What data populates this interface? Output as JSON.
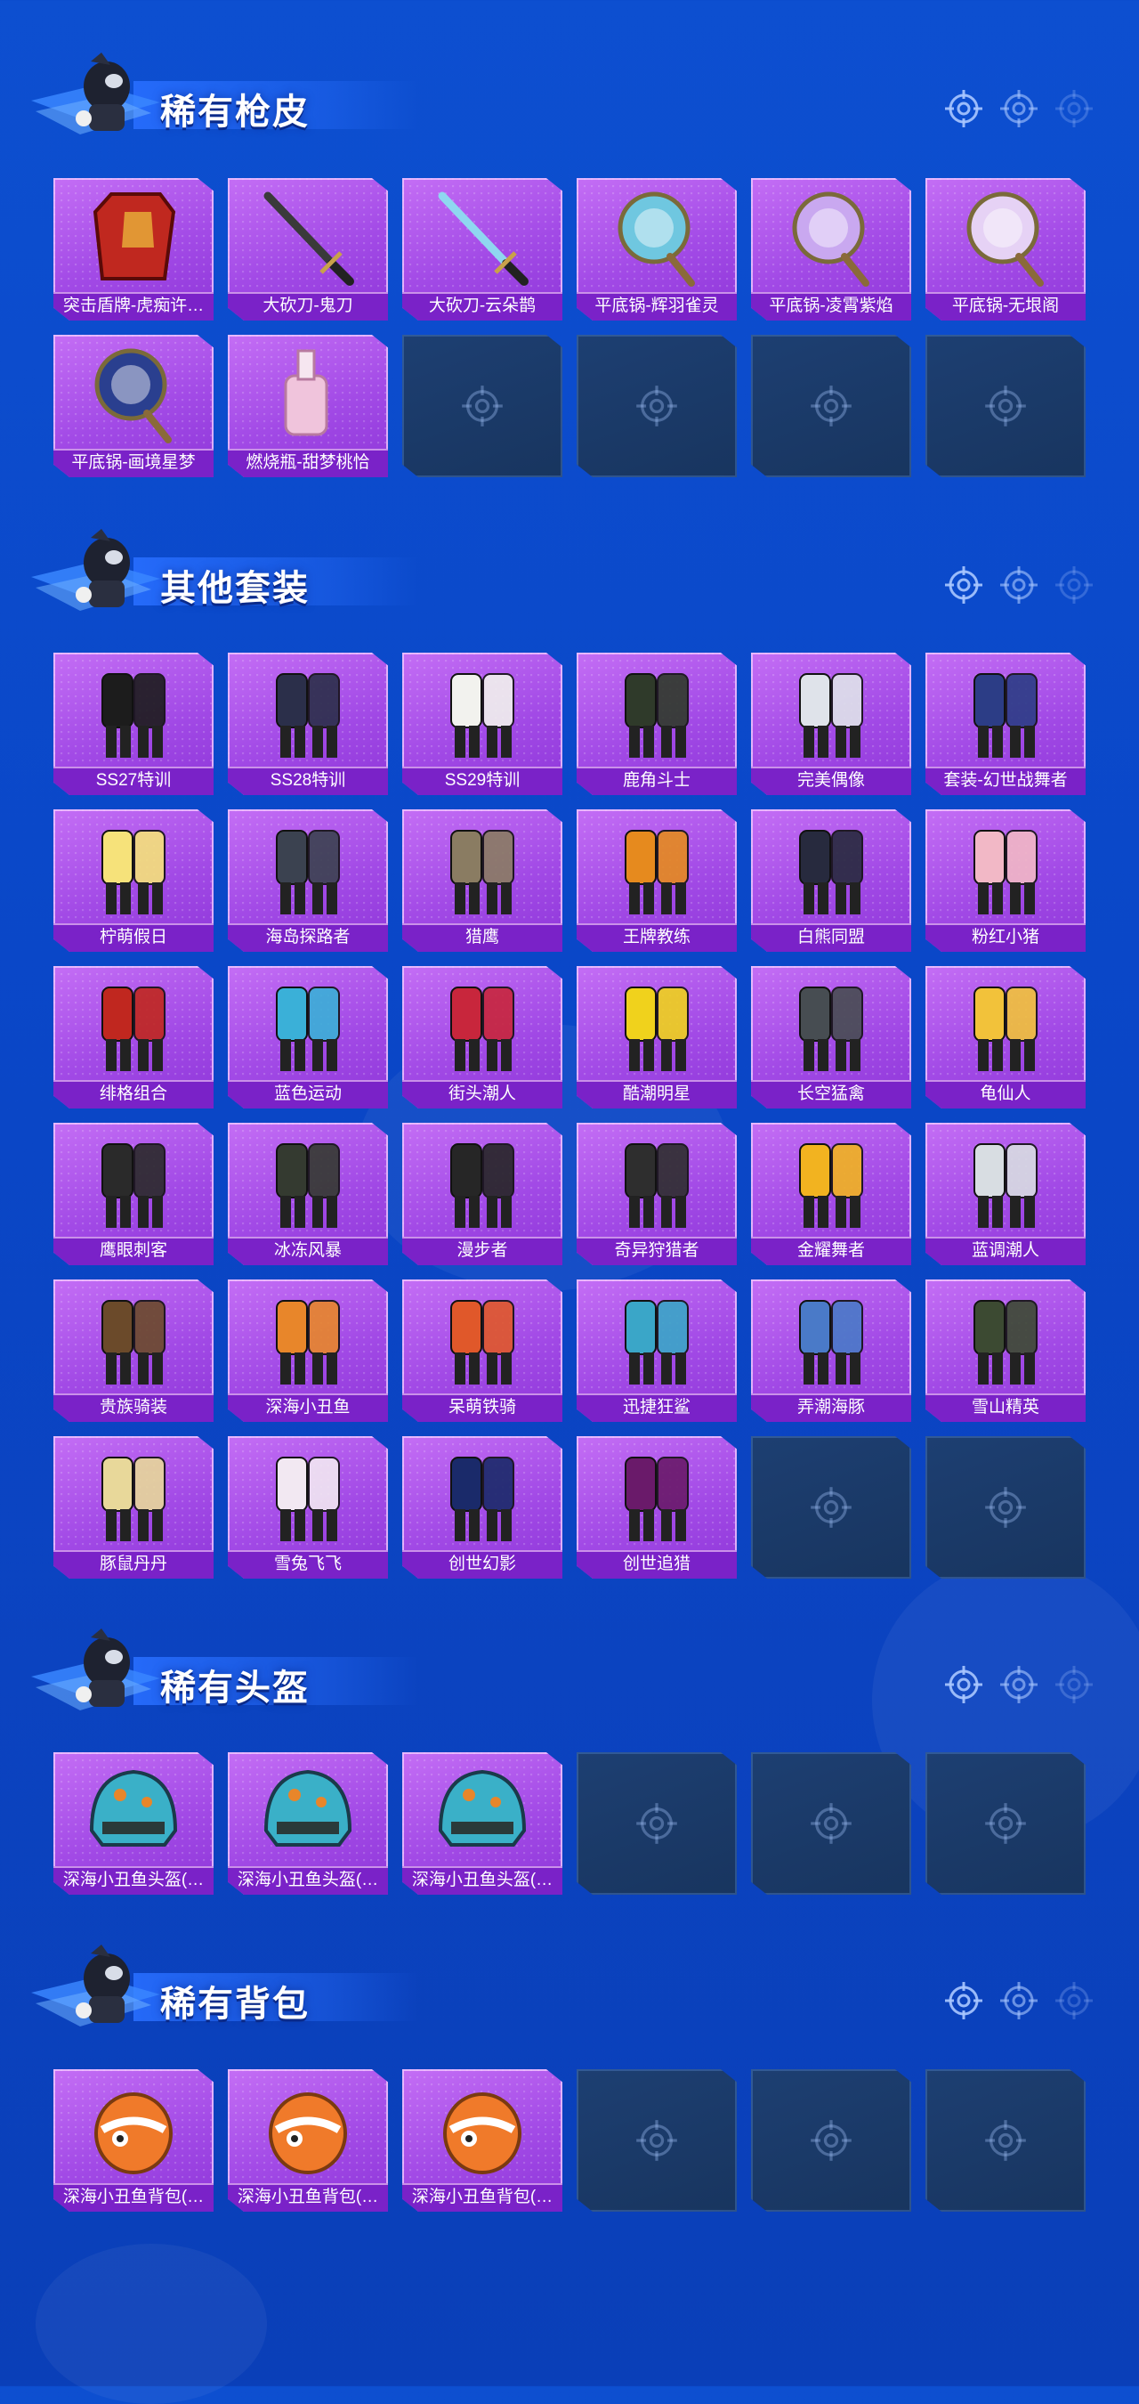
{
  "sections": [
    {
      "title": "稀有枪皮",
      "items": [
        {
          "label": "突击盾牌-虎痴许…",
          "icon": "shield-skin",
          "color": "#c0281f"
        },
        {
          "label": "大砍刀-鬼刀",
          "icon": "machete-skin",
          "color": "#3a3a3a"
        },
        {
          "label": "大砍刀-云朵鹊",
          "icon": "machete-skin",
          "color": "#8fd7f0"
        },
        {
          "label": "平底锅-辉羽雀灵",
          "icon": "pan-skin",
          "color": "#6fc7e0"
        },
        {
          "label": "平底锅-凌霄紫焰",
          "icon": "pan-skin",
          "color": "#c9a8f0"
        },
        {
          "label": "平底锅-无垠阁",
          "icon": "pan-skin",
          "color": "#e6d2f5"
        },
        {
          "label": "平底锅-画境星梦",
          "icon": "pan-skin",
          "color": "#2a3f8f"
        },
        {
          "label": "燃烧瓶-甜梦桃恰",
          "icon": "bottle-skin",
          "color": "#f0c4dc"
        },
        null,
        null,
        null,
        null
      ]
    },
    {
      "title": "其他套装",
      "items": [
        {
          "label": "SS27特训",
          "icon": "outfit",
          "color": "#1c1c1c"
        },
        {
          "label": "SS28特训",
          "icon": "outfit",
          "color": "#2b2f4a"
        },
        {
          "label": "SS29特训",
          "icon": "outfit",
          "color": "#f2f2ee"
        },
        {
          "label": "鹿角斗士",
          "icon": "outfit",
          "color": "#2f3a2a"
        },
        {
          "label": "完美偶像",
          "icon": "outfit",
          "color": "#dfe3ea"
        },
        {
          "label": "套装-幻世战舞者",
          "icon": "outfit",
          "color": "#2c3d86"
        },
        {
          "label": "柠萌假日",
          "icon": "outfit",
          "color": "#f6e27a"
        },
        {
          "label": "海岛探路者",
          "icon": "outfit",
          "color": "#3b4250"
        },
        {
          "label": "猎鹰",
          "icon": "outfit",
          "color": "#8a7c62"
        },
        {
          "label": "王牌教练",
          "icon": "outfit",
          "color": "#e68a1e"
        },
        {
          "label": "白熊同盟",
          "icon": "outfit",
          "color": "#272a3e"
        },
        {
          "label": "粉红小猪",
          "icon": "outfit",
          "color": "#f2b8c6"
        },
        {
          "label": "绯格组合",
          "icon": "outfit",
          "color": "#c0271f"
        },
        {
          "label": "蓝色运动",
          "icon": "outfit",
          "color": "#3ab0d8"
        },
        {
          "label": "街头潮人",
          "icon": "outfit",
          "color": "#c8263c"
        },
        {
          "label": "酷潮明星",
          "icon": "outfit",
          "color": "#f0d21c"
        },
        {
          "label": "长空猛禽",
          "icon": "outfit",
          "color": "#474d52"
        },
        {
          "label": "龟仙人",
          "icon": "outfit",
          "color": "#f2c23a"
        },
        {
          "label": "鹰眼刺客",
          "icon": "outfit",
          "color": "#2a2a2a"
        },
        {
          "label": "冰冻风暴",
          "icon": "outfit",
          "color": "#343a30"
        },
        {
          "label": "漫步者",
          "icon": "outfit",
          "color": "#262626"
        },
        {
          "label": "奇异狩猎者",
          "icon": "outfit",
          "color": "#2e2e2e"
        },
        {
          "label": "金耀舞者",
          "icon": "outfit",
          "color": "#f2b320"
        },
        {
          "label": "蓝调潮人",
          "icon": "outfit",
          "color": "#d8dde2"
        },
        {
          "label": "贵族骑装",
          "icon": "outfit",
          "color": "#6b4a2a"
        },
        {
          "label": "深海小丑鱼",
          "icon": "outfit",
          "color": "#e8862a"
        },
        {
          "label": "呆萌铁骑",
          "icon": "outfit",
          "color": "#e0582a"
        },
        {
          "label": "迅捷狂鲨",
          "icon": "outfit",
          "color": "#3aa6c8"
        },
        {
          "label": "弄潮海豚",
          "icon": "outfit",
          "color": "#4a7ac8"
        },
        {
          "label": "雪山精英",
          "icon": "outfit",
          "color": "#3c4a32"
        },
        {
          "label": "豚鼠丹丹",
          "icon": "outfit",
          "color": "#e8d89a"
        },
        {
          "label": "雪兔飞飞",
          "icon": "outfit",
          "color": "#f2e8f2"
        },
        {
          "label": "创世幻影",
          "icon": "outfit",
          "color": "#1a2a6a"
        },
        {
          "label": "创世追猎",
          "icon": "outfit",
          "color": "#6a1a6a"
        },
        null,
        null
      ]
    },
    {
      "title": "稀有头盔",
      "items": [
        {
          "label": "深海小丑鱼头盔(…",
          "icon": "helmet",
          "color": "#3ab0c8"
        },
        {
          "label": "深海小丑鱼头盔(…",
          "icon": "helmet",
          "color": "#3ab0c8"
        },
        {
          "label": "深海小丑鱼头盔(…",
          "icon": "helmet",
          "color": "#3ab0c8"
        },
        null,
        null,
        null
      ]
    },
    {
      "title": "稀有背包",
      "items": [
        {
          "label": "深海小丑鱼背包(…",
          "icon": "backpack",
          "color": "#f07a2a"
        },
        {
          "label": "深海小丑鱼背包(…",
          "icon": "backpack",
          "color": "#f07a2a"
        },
        {
          "label": "深海小丑鱼背包(…",
          "icon": "backpack",
          "color": "#f07a2a"
        },
        null,
        null,
        null
      ]
    }
  ]
}
